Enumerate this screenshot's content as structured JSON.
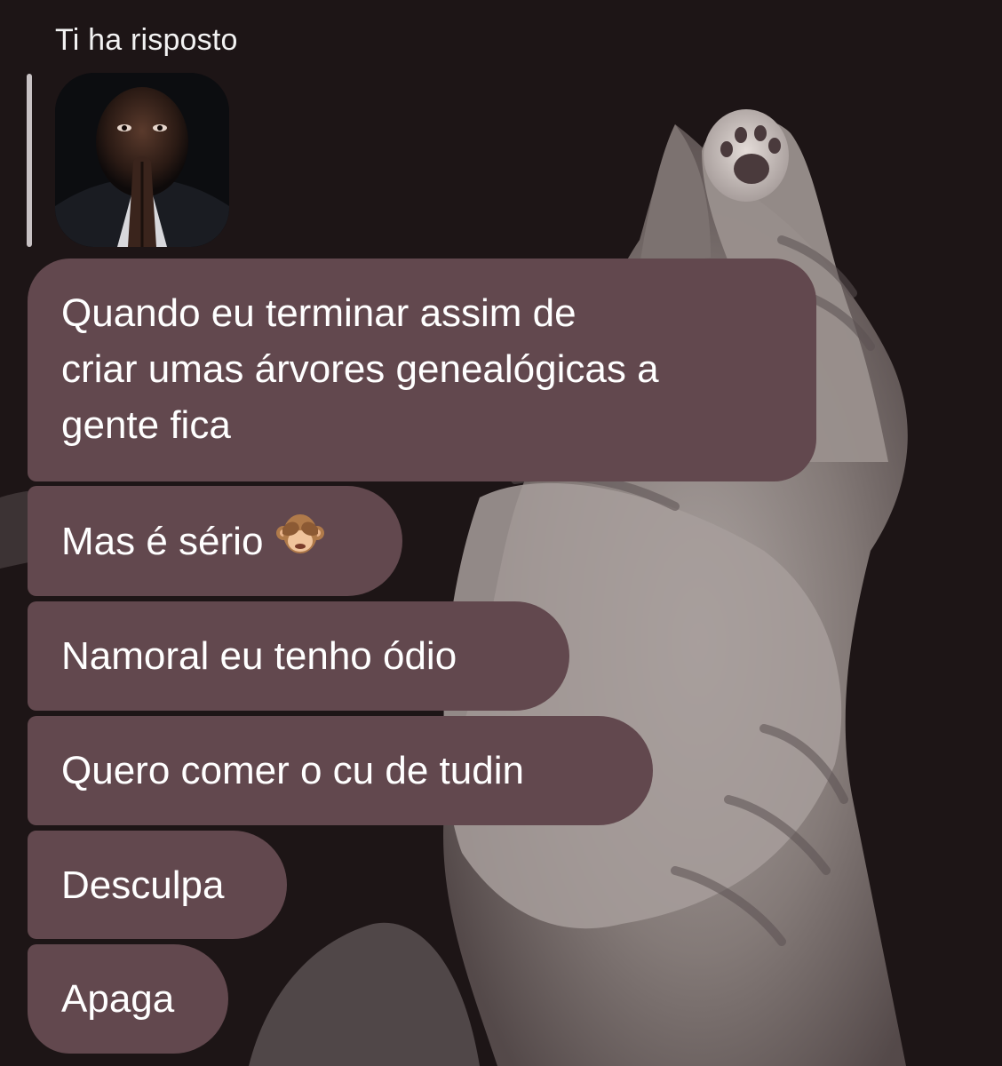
{
  "reply": {
    "header": "Ti ha risposto",
    "thumbnail_icon": "person-photo-thumbnail"
  },
  "messages": [
    {
      "text_lines": [
        "Quando eu terminar assim de",
        "criar umas árvores genealógicas a",
        "gente fica"
      ]
    },
    {
      "text": "Mas é sério",
      "emoji": "see-no-evil-monkey"
    },
    {
      "text": "Namoral eu tenho ódio"
    },
    {
      "text": "Quero comer o cu de tudin"
    },
    {
      "text": "Desculpa"
    },
    {
      "text": "Apaga"
    }
  ],
  "colors": {
    "background": "#1d1516",
    "bubble": "#62484e",
    "text": "#ffffff",
    "reply_bar": "#c8c2c4"
  }
}
